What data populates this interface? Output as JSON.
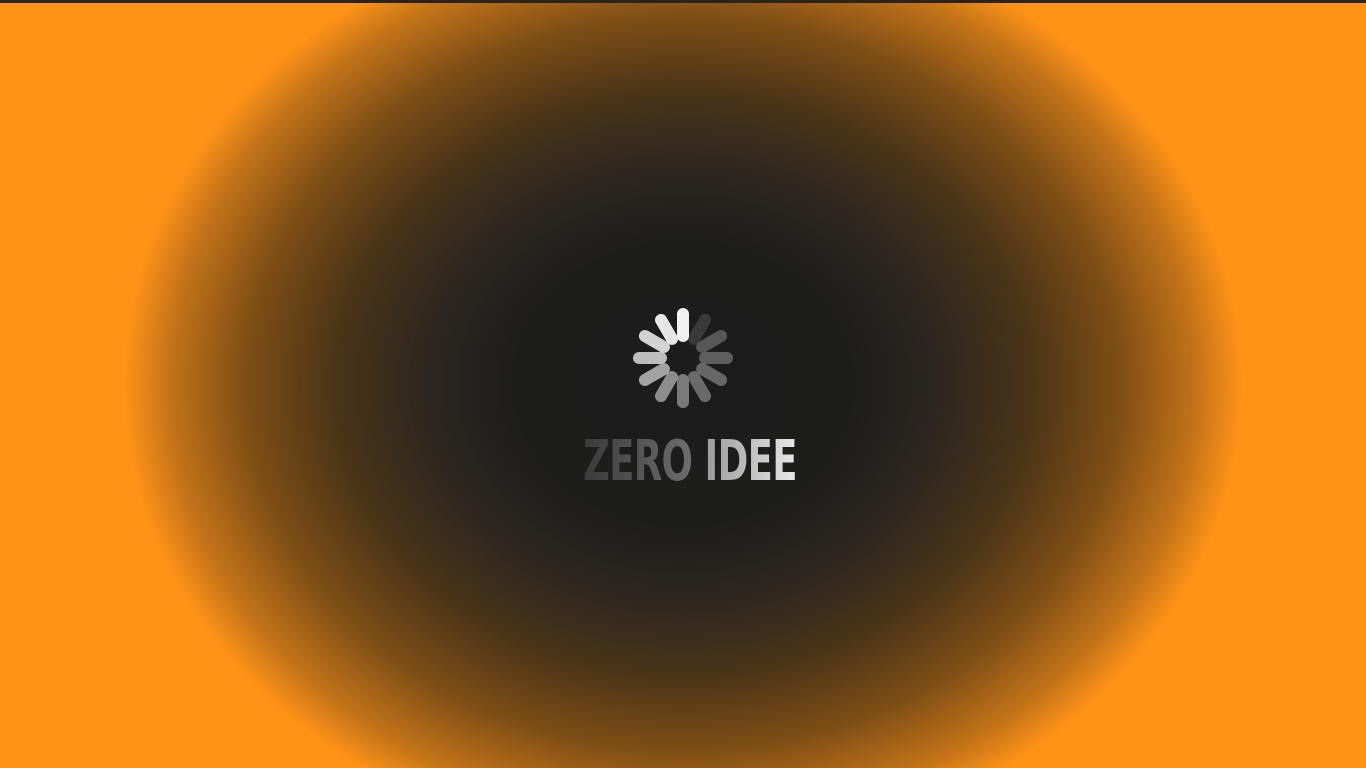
{
  "screen": {
    "background_color": "#ff9317",
    "vignette_color": "#1c1c1c"
  },
  "loader": {
    "icon": "loading-spinner-icon",
    "spoke_count": 12,
    "spoke_colors": [
      "#3a3a3a",
      "#575757",
      "#5e5e5e",
      "#666666",
      "#6a6a6a",
      "#7a7a7a",
      "#8d8d8d",
      "#a3a3a3",
      "#bdbdbd",
      "#d3d3d3",
      "#e6e6e6",
      "#f2f2f2"
    ]
  },
  "brand": {
    "word_1": "ZERO",
    "word_2": "IDEE"
  }
}
